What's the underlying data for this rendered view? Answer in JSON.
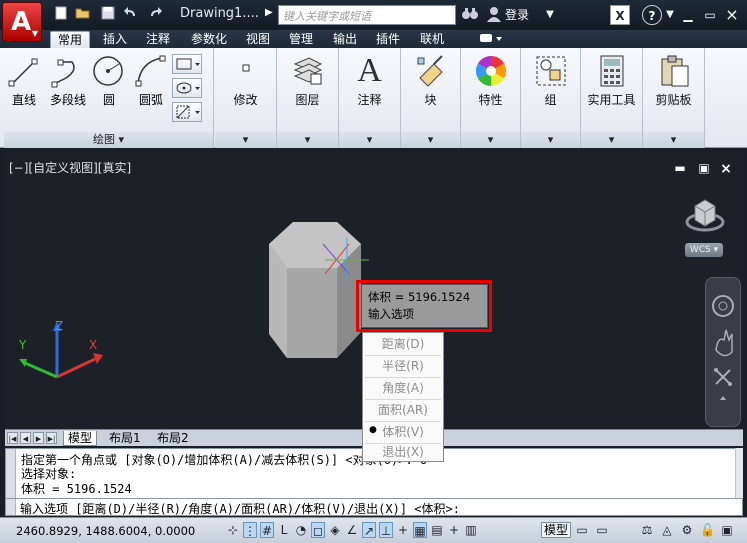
{
  "titlebar": {
    "title": "Drawing1....",
    "search_placeholder": "键入关键字或短语",
    "login": "登录"
  },
  "tabs": [
    "常用",
    "插入",
    "注释",
    "参数化",
    "视图",
    "管理",
    "输出",
    "插件",
    "联机"
  ],
  "ribbon": {
    "draw_tools": [
      "直线",
      "多段线",
      "圆",
      "圆弧"
    ],
    "draw_panel_label": "绘图",
    "panels": [
      "修改",
      "图层",
      "注释",
      "块",
      "特性",
      "组",
      "实用工具",
      "剪贴板"
    ]
  },
  "viewport": {
    "label": "[−][自定义视图][真实]",
    "wcs": "WCS",
    "axes": {
      "x": "X",
      "y": "Y",
      "z": "Z"
    }
  },
  "tooltip": {
    "line1": "体积 = 5196.1524",
    "line2": "输入选项"
  },
  "context_menu": {
    "items": [
      "距离(D)",
      "半径(R)",
      "角度(A)",
      "面积(AR)",
      "体积(V)",
      "退出(X)"
    ],
    "selected": "体积(V)"
  },
  "layout_tabs": [
    "模型",
    "布局1",
    "布局2"
  ],
  "command": {
    "history": [
      "指定第一个角点或 [对象(O)/增加体积(A)/减去体积(S)] <对象(O)>: o",
      "选择对象:",
      "体积 = 5196.1524"
    ],
    "prompt": "输入选项 [距离(D)/半径(R)/角度(A)/面积(AR)/体积(V)/退出(X)] <体积>:"
  },
  "status": {
    "coords": "2460.8929, 1488.6004, 0.0000",
    "model": "模型"
  }
}
